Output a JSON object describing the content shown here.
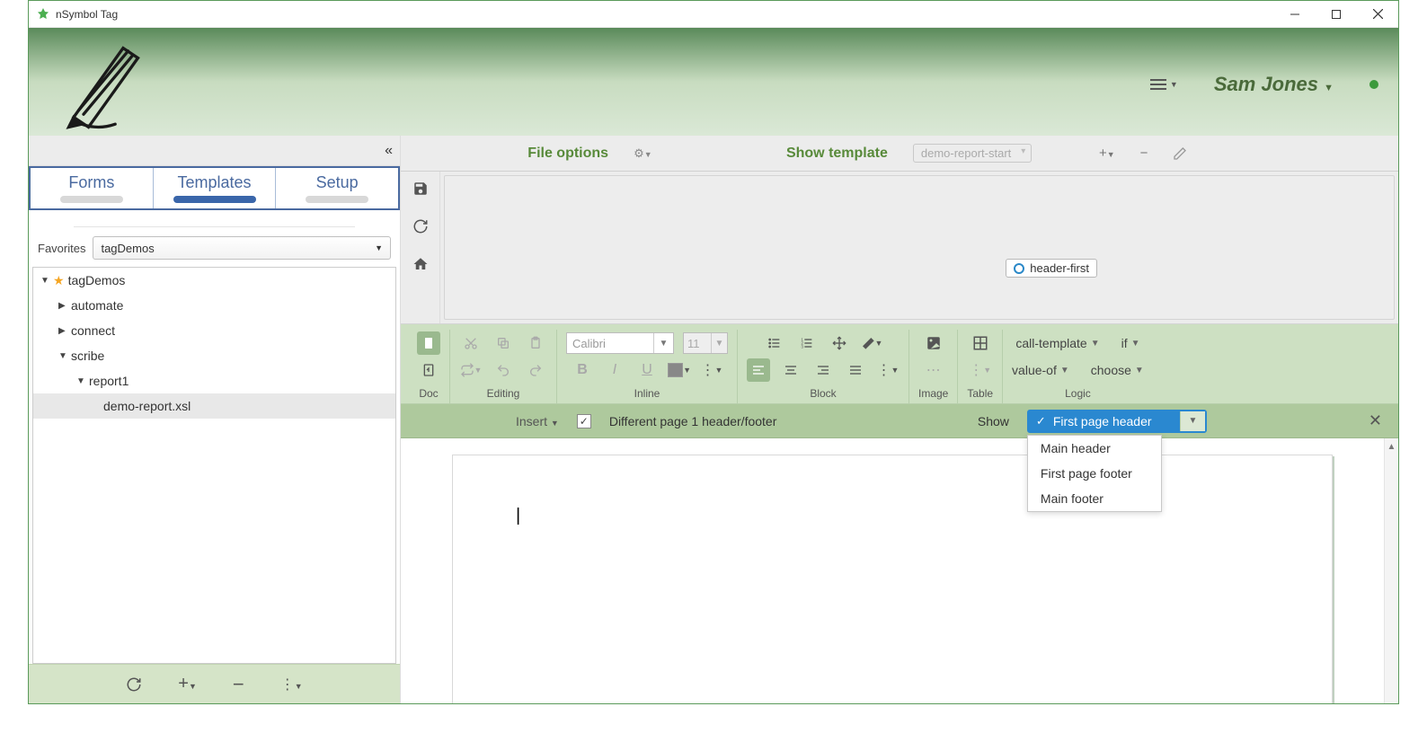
{
  "window": {
    "title": "nSymbol Tag"
  },
  "header": {
    "user": "Sam Jones"
  },
  "sidebar": {
    "tabs": [
      "Forms",
      "Templates",
      "Setup"
    ],
    "active_tab_index": 1,
    "favorites_label": "Favorites",
    "favorites_value": "tagDemos",
    "tree": {
      "root": "tagDemos",
      "nodes": [
        {
          "label": "automate",
          "expanded": false,
          "depth": 1
        },
        {
          "label": "connect",
          "expanded": false,
          "depth": 1
        },
        {
          "label": "scribe",
          "expanded": true,
          "depth": 1
        },
        {
          "label": "report1",
          "expanded": true,
          "depth": 2
        },
        {
          "label": "demo-report.xsl",
          "expanded": null,
          "depth": 3,
          "selected": true
        }
      ]
    }
  },
  "toolbar": {
    "file_options": "File options",
    "show_template": "Show template",
    "template_name": "demo-report-start"
  },
  "canvas": {
    "chip_label": "header-first"
  },
  "ribbon": {
    "font_name": "Calibri",
    "font_size": "11",
    "groups": [
      "Doc",
      "Editing",
      "Inline",
      "Block",
      "Image",
      "Table",
      "Logic"
    ],
    "logic": {
      "call_template": "call-template",
      "if": "if",
      "value_of": "value-of",
      "choose": "choose"
    }
  },
  "subbar": {
    "insert": "Insert",
    "checkbox_label": "Different page 1 header/footer",
    "show_label": "Show",
    "show_selected": "First page header",
    "show_options": [
      "Main header",
      "First page footer",
      "Main footer"
    ]
  }
}
